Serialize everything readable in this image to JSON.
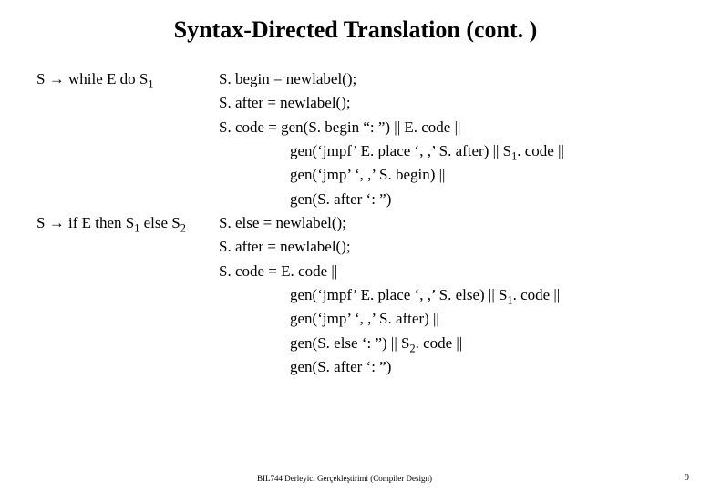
{
  "title": "Syntax-Directed Translation (cont. )",
  "rules": {
    "while": {
      "production_pre": "S ",
      "arrow": "→",
      "production_post": " while E do S",
      "production_sub": "1",
      "lines": [
        "S. begin = newlabel();",
        "S. after = newlabel();",
        "S. code = gen(S. begin “: ”)  ||  E. code  ||"
      ],
      "indent_plain": [
        "gen(‘jmp’ ‘, ,’ S. begin)  ||",
        "gen(S. after ‘: ”)"
      ],
      "indent_sub": {
        "pre": "gen(‘jmpf’ E. place ‘, ,’ S. after)  || S",
        "sub": "1",
        "post": ". code ||"
      }
    },
    "ifelse": {
      "production_pre": "S ",
      "arrow": "→",
      "production_mid1": " if E then S",
      "production_sub1": "1",
      "production_mid2": " else S",
      "production_sub2": "2",
      "lines": [
        "S. else = newlabel();",
        "S. after = newlabel();",
        "S. code = E. code  ||"
      ],
      "indent_sub_a": {
        "pre": "gen(‘jmpf’ E. place ‘, ,’ S. else)  || S",
        "sub": "1",
        "post": ". code ||"
      },
      "indent_plain_a": "gen(‘jmp’ ‘, ,’ S. after)  ||",
      "indent_sub_b": {
        "pre": "gen(S. else ‘: ”) || S",
        "sub": "2",
        "post": ". code ||"
      },
      "indent_plain_b": "gen(S. after ‘: ”)"
    }
  },
  "footer": {
    "course": "BIL744 Derleyici Gerçekleştirimi (Compiler Design)",
    "page": "9"
  }
}
